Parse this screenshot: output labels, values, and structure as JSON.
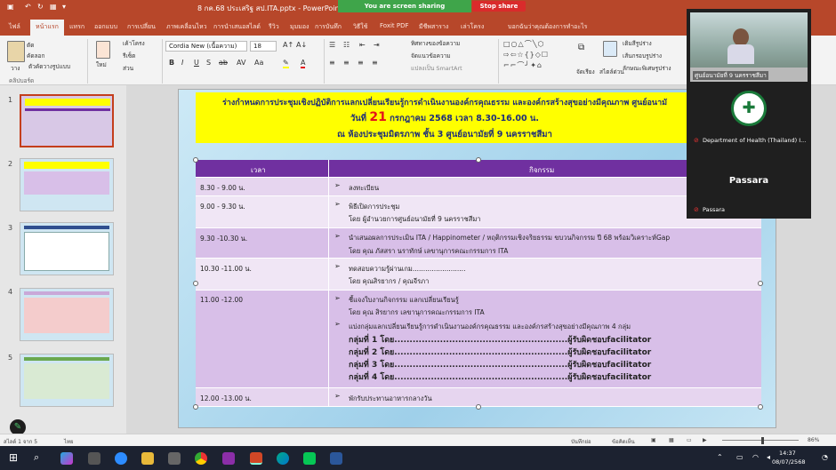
{
  "titlebar": {
    "doc_title": "8 กค.68 ประเสริฐ สป.ITA.pptx  -  PowerPoint",
    "share_text": "You are screen sharing",
    "stop_label": "Stop share",
    "quick_icons": [
      "save-icon",
      "undo-icon",
      "redo-icon",
      "slideshow-icon"
    ]
  },
  "tabs": [
    "ไฟล์",
    "หน้าแรก",
    "แทรก",
    "ออกแบบ",
    "การเปลี่ยน",
    "ภาพเคลื่อนไหว",
    "การนำเสนอสไลด์",
    "รีวิว",
    "มุมมอง",
    "การบันทึก",
    "วิธีใช้",
    "Foxit PDF",
    "มีชีพสาราง",
    "เล่าโครง",
    "บอกฉันว่าคุณต้องการทำอะไร"
  ],
  "active_tab": "หน้าแรก",
  "ribbon": {
    "paste_label": "วาง",
    "clipboard_label": "คลิปบอร์ด",
    "new_slide_label": "ใหม่",
    "cut_label": "ตัด",
    "copy_label": "คัดลอก",
    "format_painter_label": "ตัวคัดวางรูปแบบ",
    "layout_label": "เค้าโครง",
    "reset_label": "รีเซ็ต",
    "section_label": "ส่วน",
    "font_name": "Cordia New (เนื้อความ)",
    "font_size": "18",
    "text_direction_label": "ทิศทางของข้อความ",
    "align_text_label": "จัดแนวข้อความ",
    "smartart_label": "แปลงเป็น SmartArt",
    "arrange_label": "จัดเรียง",
    "quick_styles_label": "สไตล์ด่วน",
    "shape_fill_label": "เติมสีรูปร่าง",
    "shape_outline_label": "เส้นกรอบรูปร่าง",
    "shape_effects_label": "ลักษณะพิเศษรูปร่าง"
  },
  "thumbnails": [
    "1",
    "2",
    "3",
    "4",
    "5"
  ],
  "slide": {
    "title1": "ร่างกำหนดการประชุมเชิงปฏิบัติการแลกเปลี่ยนเรียนรู้การดำเนินงานองค์กรคุณธรรม และองค์กรสร้างสุขอย่างมีคุณภาพ ศูนย์อนามั",
    "title2_pre": "วันที่ ",
    "title2_day": "21",
    "title2_post": " กรกฎาคม 2568 เวลา 8.30-16.00 น.",
    "title3": "ณ ห้องประชุมมิตรภาพ ชั้น 3 ศูนย์อนามัยที่ 9 นครราชสีมา",
    "col_time": "เวลา",
    "col_activity": "กิจกรรม",
    "rows": [
      {
        "time": "8.30 - 9.00 น.",
        "lines": [
          "ลงทะเบียน"
        ]
      },
      {
        "time": "9.00 - 9.30 น.",
        "lines": [
          "พิธีเปิดการประชุม",
          "โดย ผู้อำนวยการศูนย์อนามัยที่ 9 นครราชสีมา"
        ]
      },
      {
        "time": "9.30 -10.30 น.",
        "lines": [
          "นำเสนอผลการประเมิน ITA / Happinometer / หฤติกรรมเชิงจริยธรรม ขบวนกิจกรรม ปี 68 พร้อมวิเคราะห์Gap",
          "โดย คุณ ภัสสรา นราทักษ์ เลขานุการคณะกรรมการ ITA"
        ]
      },
      {
        "time": "10.30 -11.00 น.",
        "lines": [
          "ทดสอบความรู้ผ่านเกม.........................",
          "โดย คุณสิรยากร / คุณจีรภา"
        ]
      },
      {
        "time": "11.00 -12.00",
        "lines": [
          "ชี้แจงใบงานกิจกรรม แลกเปลี่ยนเรียนรู้",
          "โดย คุณ สิรยากร เลขานุการคณะกรรมการ ITA",
          "แบ่งกลุ่มแลกเปลี่ยนเรียนรู้การดำเนินงานองค์กรคุณธรรม และองค์กรสร้างสุขอย่างมีคุณภาพ 4 กลุ่ม",
          "กลุ่มที่ 1 โดย.........................................................ผู้รับผิดชอบfacilitator",
          "กลุ่มที่ 2 โดย.........................................................ผู้รับผิดชอบfacilitator",
          "กลุ่มที่ 3 โดย.........................................................ผู้รับผิดชอบfacilitator",
          "กลุ่มที่ 4 โดย.........................................................ผู้รับผิดชอบfacilitator"
        ]
      },
      {
        "time": "12.00 -13.00 น.",
        "lines": [
          "พักรับประทานอาหารกลางวัน"
        ]
      }
    ]
  },
  "video": {
    "tile1_name": "ศูนย์อนามัยที่ 9 นครราชสีมา",
    "tile2_name": "Department of Health (Thailand) I...",
    "tile3_big": "Passara",
    "tile3_name": "Passara"
  },
  "status": {
    "slide_count": "สไลด์ 1 จาก 5",
    "language": "ไทย",
    "notes": "บันทึกย่อ",
    "comments": "ข้อคิดเห็น",
    "zoom": "86%"
  },
  "taskbar": {
    "time": "14:37",
    "date": "08/07/2568"
  },
  "colors": {
    "accent": "#b7472a",
    "header_purple": "#7030a0",
    "row_light": "#e6d5ef",
    "row_mid": "#d8bfe8",
    "title_yellow": "#ffff00"
  }
}
